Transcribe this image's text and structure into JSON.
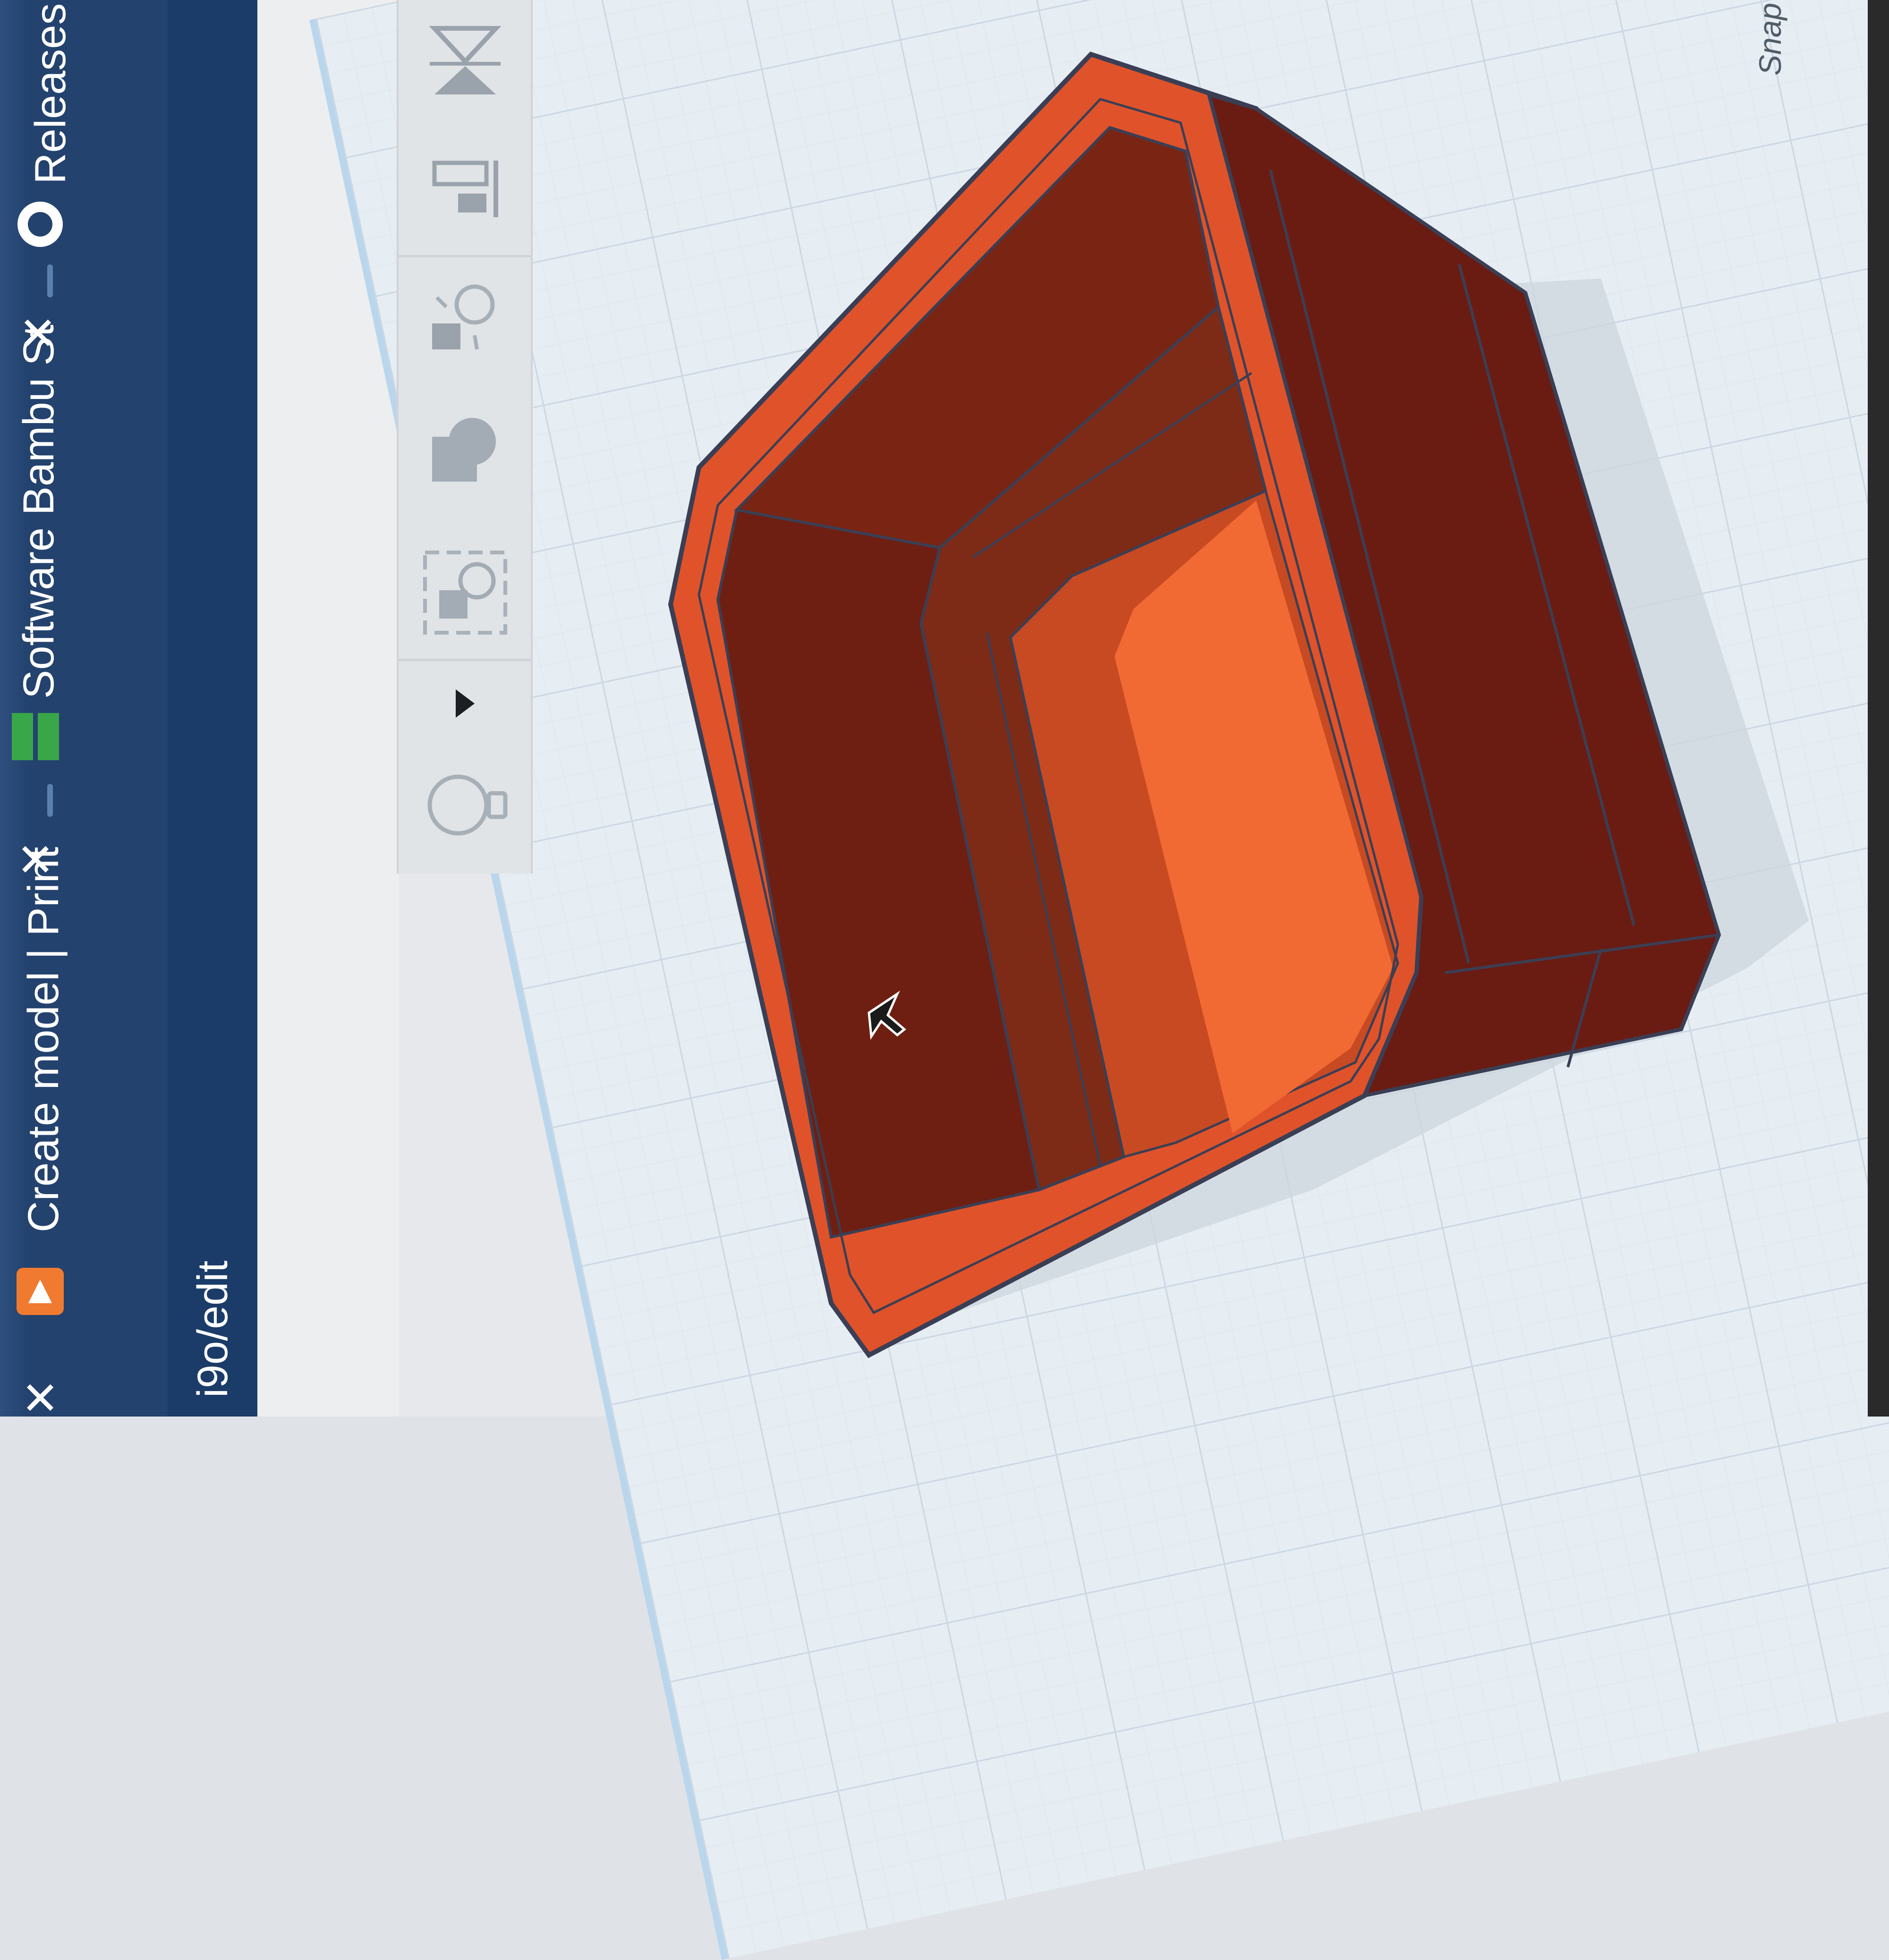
{
  "browser": {
    "tabs": [
      {
        "label": "Create model | Print",
        "icon": "printables-logo-icon",
        "close": "✕"
      },
      {
        "label": "Software Bambu St",
        "icon": "bambu-logo-icon",
        "close": "✕"
      },
      {
        "label": "Releases · ba",
        "icon": "github-logo-icon",
        "close": "✕"
      }
    ],
    "leading_close": "✕",
    "address_fragment": "i9o/edit"
  },
  "toolbar": {
    "tools": [
      {
        "name": "notes-lightbulb",
        "icon": "lightbulb-icon"
      },
      {
        "name": "more-dropdown",
        "icon": "triangle-right-icon"
      },
      {
        "name": "group",
        "icon": "group-icon"
      },
      {
        "name": "shape-combine",
        "icon": "shapes-icon"
      },
      {
        "name": "cruise",
        "icon": "cruise-icon"
      },
      {
        "name": "align",
        "icon": "align-icon"
      },
      {
        "name": "mirror",
        "icon": "mirror-icon"
      }
    ]
  },
  "workplane": {
    "snap_label": "Snap",
    "colors": {
      "model_dark": "#6a1b10",
      "model_mid": "#8a2a16",
      "model_rim": "#e0522a",
      "model_floor": "#f26a33",
      "grid": "#cbd7e2",
      "plane": "#e7eef3"
    }
  }
}
